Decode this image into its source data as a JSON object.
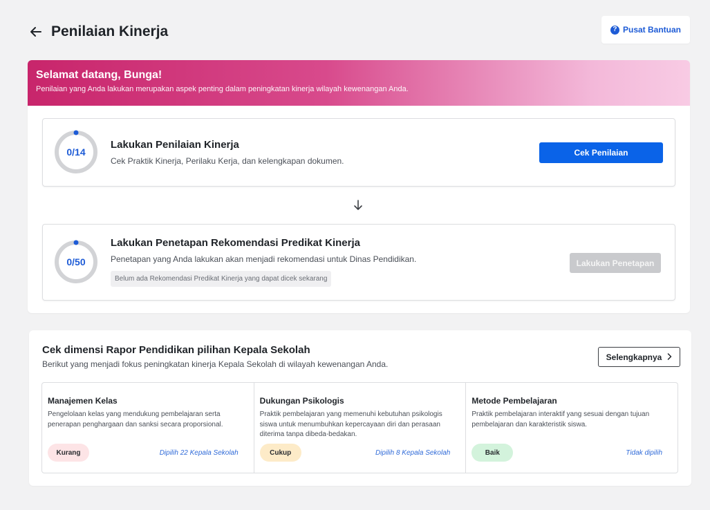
{
  "header": {
    "title": "Penilaian Kinerja",
    "help_label": "Pusat Bantuan"
  },
  "banner": {
    "title": "Selamat datang, Bunga!",
    "subtitle": "Penilaian yang Anda lakukan merupakan aspek penting dalam peningkatan kinerja wilayah kewenangan Anda."
  },
  "tasks": [
    {
      "progress_label": "0/14",
      "done": 0,
      "total": 14,
      "title": "Lakukan Penilaian Kinerja",
      "description": "Cek Praktik Kinerja, Perilaku Kerja, dan kelengkapan dokumen.",
      "button_label": "Cek Penilaian"
    },
    {
      "progress_label": "0/50",
      "done": 0,
      "total": 50,
      "title": "Lakukan Penetapan Rekomendasi Predikat Kinerja",
      "description": "Penetapan yang Anda lakukan akan menjadi rekomendasi untuk Dinas Pendidikan.",
      "note": "Belum ada Rekomendasi Predikat Kinerja yang dapat dicek sekarang",
      "button_label": "Lakukan Penetapan"
    }
  ],
  "dimensions": {
    "title": "Cek dimensi Rapor Pendidikan pilihan Kepala Sekolah",
    "subtitle": "Berikut yang menjadi fokus peningkatan kinerja Kepala Sekolah di wilayah kewenangan Anda.",
    "more_label": "Selengkapnya",
    "items": [
      {
        "name": "Manajemen Kelas",
        "description": "Pengelolaan kelas yang mendukung pembelajaran serta penerapan penghargaan dan sanksi secara proporsional.",
        "badge": "Kurang",
        "badge_color": "#fde4e6",
        "chosen": "Dipilih 22 Kepala Sekolah"
      },
      {
        "name": "Dukungan Psikologis",
        "description": "Praktik pembelajaran yang memenuhi kebutuhan psikologis siswa untuk menumbuhkan kepercayaan diri dan perasaan diterima tanpa dibeda-bedakan.",
        "badge": "Cukup",
        "badge_color": "#fdebc8",
        "chosen": "Dipilih 8 Kepala Sekolah"
      },
      {
        "name": "Metode Pembelajaran",
        "description": "Praktik pembelajaran interaktif yang sesuai dengan tujuan pembelajaran dan karakteristik siswa.",
        "badge": "Baik",
        "badge_color": "#d3f3dc",
        "chosen": "Tidak dipilih"
      }
    ]
  },
  "colors": {
    "primary": "#0a63e8",
    "accent_pink": "#c8256b",
    "link_blue": "#2f6ad8"
  }
}
